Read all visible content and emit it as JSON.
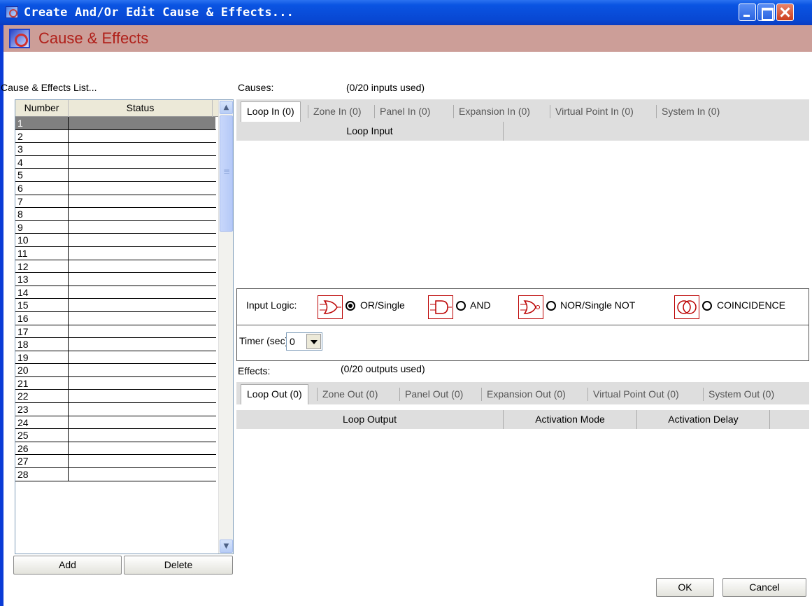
{
  "window": {
    "title": "Create And/Or Edit Cause & Effects..."
  },
  "header": {
    "title": "Cause & Effects"
  },
  "list": {
    "label": "Cause & Effects List...",
    "columns": [
      "Number",
      "Status"
    ],
    "rows": [
      "1",
      "2",
      "3",
      "4",
      "5",
      "6",
      "7",
      "8",
      "9",
      "10",
      "11",
      "12",
      "13",
      "14",
      "15",
      "16",
      "17",
      "18",
      "19",
      "20",
      "21",
      "22",
      "23",
      "24",
      "25",
      "26",
      "27",
      "28"
    ],
    "selected": "1",
    "add_label": "Add",
    "delete_label": "Delete"
  },
  "causes": {
    "label": "Causes:",
    "usage": "(0/20 inputs used)",
    "tabs": [
      "Loop In (0)",
      "Zone In (0)",
      "Panel In (0)",
      "Expansion In (0)",
      "Virtual Point In (0)",
      "System In (0)"
    ],
    "active_tab": "Loop In (0)",
    "grid_columns": [
      "Loop Input"
    ]
  },
  "logic": {
    "label": "Input Logic:",
    "options": [
      "OR/Single",
      "AND",
      "NOR/Single NOT",
      "COINCIDENCE"
    ],
    "selected": "OR/Single",
    "timer_label": "Timer (sec):",
    "timer_value": "0"
  },
  "effects": {
    "label": "Effects:",
    "usage": "(0/20 outputs used)",
    "tabs": [
      "Loop Out (0)",
      "Zone Out (0)",
      "Panel Out (0)",
      "Expansion Out (0)",
      "Virtual Point Out (0)",
      "System Out (0)"
    ],
    "active_tab": "Loop Out (0)",
    "grid_columns": [
      "Loop Output",
      "Activation Mode",
      "Activation Delay"
    ]
  },
  "dialog": {
    "ok_label": "OK",
    "cancel_label": "Cancel"
  },
  "colors": {
    "titlebar": "#0a54e2",
    "header_band": "#cc9e98",
    "header_text": "#b0201a",
    "selection": "#808080",
    "tab_strip": "#dedede"
  }
}
